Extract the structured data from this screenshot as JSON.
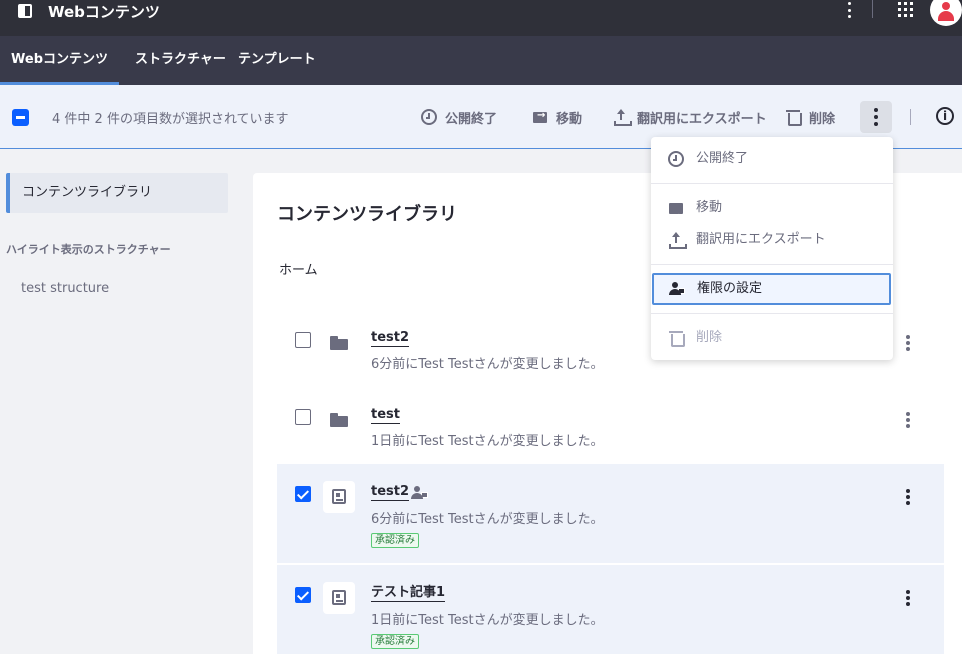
{
  "topbar": {
    "title": "Webコンテンツ"
  },
  "tabs": [
    {
      "label": "Webコンテンツ",
      "active": true
    },
    {
      "label": "ストラクチャー",
      "active": false
    },
    {
      "label": "テンプレート",
      "active": false
    }
  ],
  "management": {
    "status": "4 件中 2 件の項目数が選択されています",
    "actions": [
      "公開終了",
      "移動",
      "翻訳用にエクスポート",
      "削除"
    ]
  },
  "sidebar": {
    "active_item": "コンテンツライブラリ",
    "heading": "ハイライト表示のストラクチャー",
    "items": [
      "test structure"
    ]
  },
  "main": {
    "title": "コンテンツライブラリ",
    "breadcrumb": "ホーム",
    "rows": [
      {
        "type": "folder",
        "title": "test2",
        "subtitle": "6分前にTest Testさんが変更しました。",
        "checked": false
      },
      {
        "type": "folder",
        "title": "test",
        "subtitle": "1日前にTest Testさんが変更しました。",
        "checked": false
      },
      {
        "type": "article",
        "title": "test2",
        "subtitle": "6分前にTest Testさんが変更しました。",
        "badge": "承認済み",
        "checked": true,
        "has_permissions_icon": true
      },
      {
        "type": "article",
        "title": "テスト記事1",
        "subtitle": "1日前にTest Testさんが変更しました。",
        "badge": "承認済み",
        "checked": true
      }
    ]
  },
  "dropdown": {
    "items": [
      "公開終了",
      "移動",
      "翻訳用にエクスポート",
      "権限の設定",
      "削除"
    ],
    "focused": "権限の設定"
  },
  "colors": {
    "topbar": "#2f3039",
    "tabs": "#393a4a",
    "accent": "#528ddb",
    "primary": "#0b5fff",
    "success": "#287d3c"
  }
}
